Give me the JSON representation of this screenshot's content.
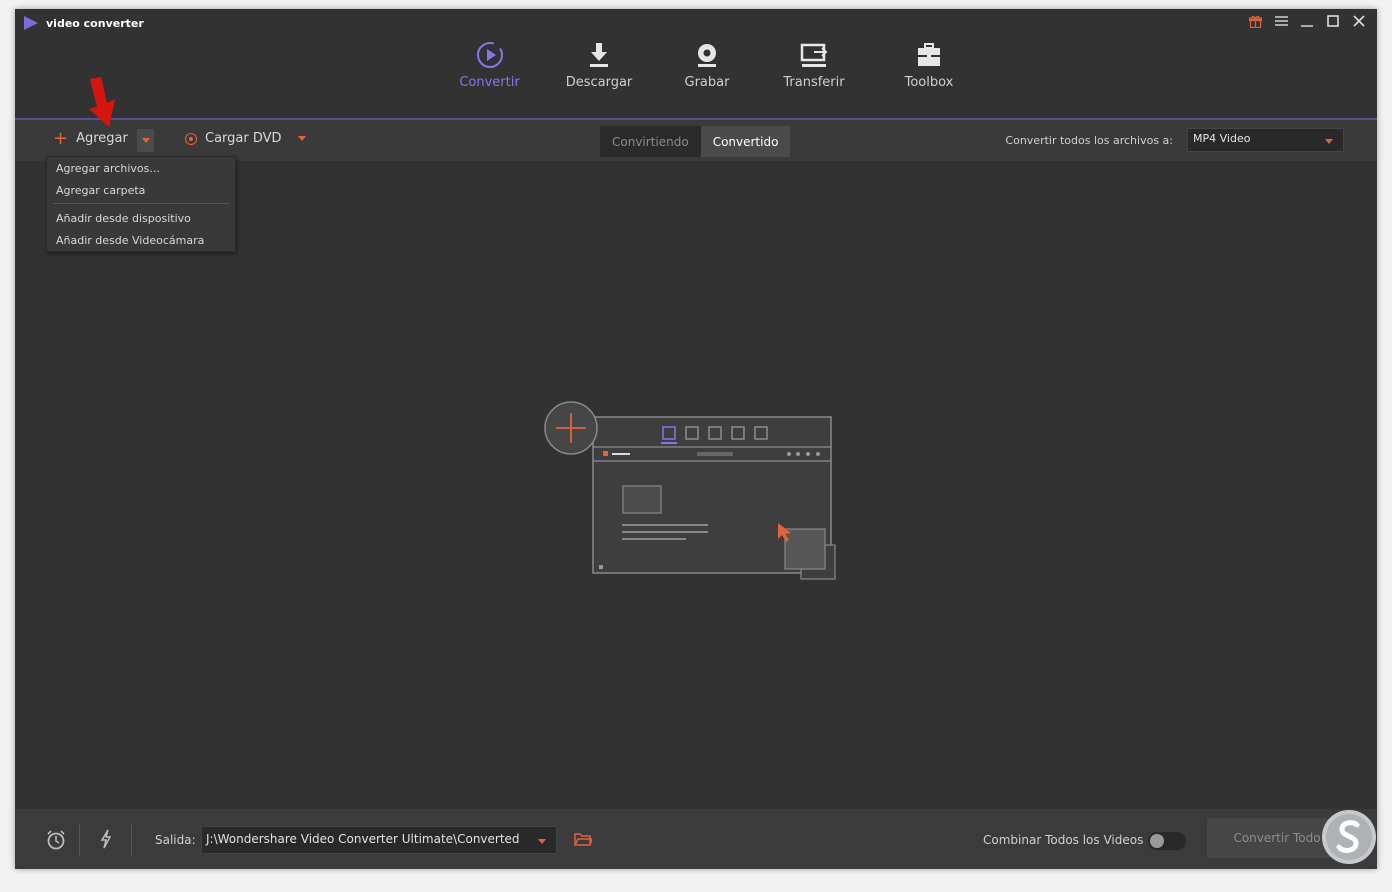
{
  "app": {
    "title": "video converter"
  },
  "nav": {
    "tabs": [
      {
        "label": "Convertir",
        "icon": "convert-icon",
        "active": true
      },
      {
        "label": "Descargar",
        "icon": "download-icon",
        "active": false
      },
      {
        "label": "Grabar",
        "icon": "burn-icon",
        "active": false
      },
      {
        "label": "Transferir",
        "icon": "transfer-icon",
        "active": false
      },
      {
        "label": "Toolbox",
        "icon": "toolbox-icon",
        "active": false
      }
    ]
  },
  "window_controls": [
    "gift-icon",
    "menu-icon",
    "minimize-icon",
    "maximize-icon",
    "close-icon"
  ],
  "toolbar": {
    "add_label": "Agregar",
    "dvd_label": "Cargar DVD",
    "segment": {
      "converting": "Convirtiendo",
      "converted": "Convertido"
    },
    "convert_all_label": "Convertir todos los archivos a:",
    "format_value": "MP4 Video"
  },
  "add_menu": {
    "items": [
      "Agregar archivos...",
      "Agregar carpeta",
      "Añadir desde dispositivo",
      "Añadir desde Videocámara"
    ]
  },
  "footer": {
    "output_label": "Salida:",
    "output_path": "J:\\Wondershare Video Converter Ultimate\\Converted",
    "combine_label": "Combinar Todos los Videos",
    "combine_on": false,
    "convert_all_button": "Convertir Todo"
  },
  "colors": {
    "accent_purple": "#8d73e6",
    "accent_orange": "#e0633e",
    "background": "#333233",
    "toolbar": "#3b3a3b"
  }
}
